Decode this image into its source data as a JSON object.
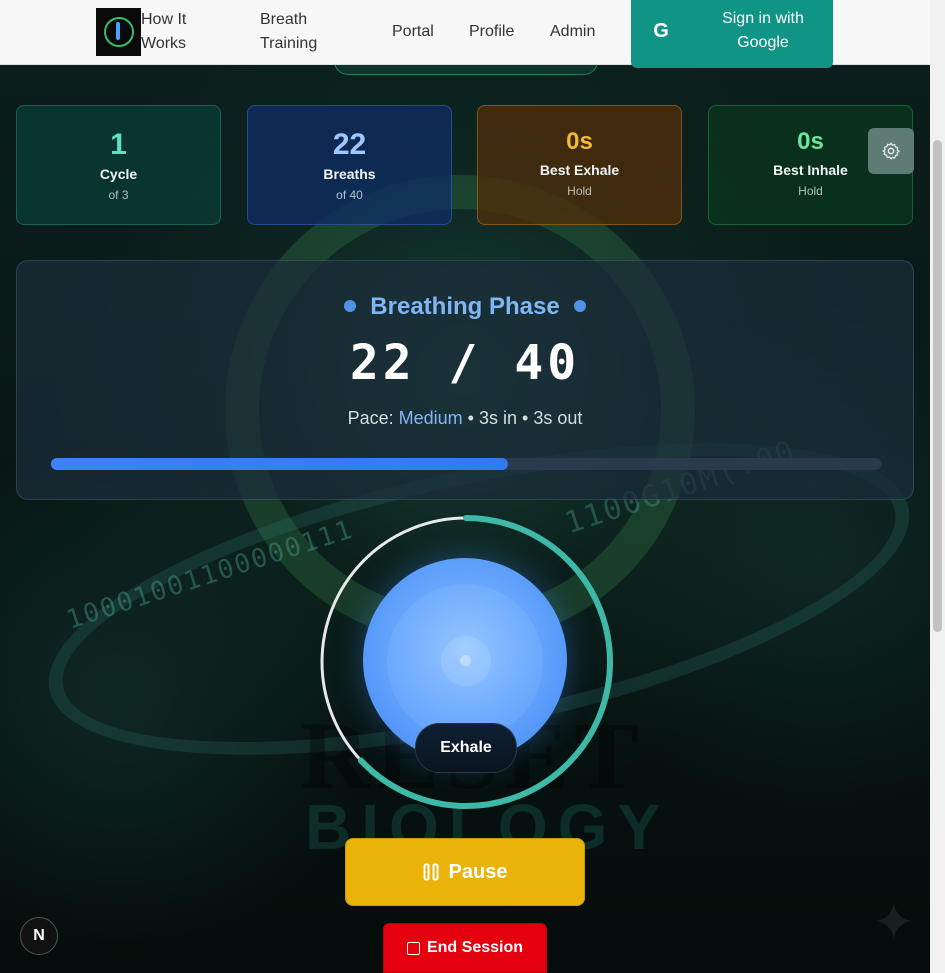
{
  "nav": {
    "links": [
      "How It Works",
      "Breath Training",
      "Portal",
      "Profile",
      "Admin"
    ],
    "signin_label": "Sign in with Google",
    "google_glyph": "G"
  },
  "stats": [
    {
      "value": "1",
      "label": "Cycle",
      "sub": "of 3",
      "color": "#5de0c8"
    },
    {
      "value": "22",
      "label": "Breaths",
      "sub": "of 40",
      "color": "#9fc7ff"
    },
    {
      "value": "0s",
      "label": "Best Exhale",
      "sub": "Hold",
      "color": "#f5b931"
    },
    {
      "value": "0s",
      "label": "Best Inhale",
      "sub": "Hold",
      "color": "#6ee49a"
    }
  ],
  "settings_icon": "gear-icon",
  "phase": {
    "title": "Breathing Phase",
    "count": "22 / 40",
    "pace_prefix": "Pace: ",
    "pace_value": "Medium",
    "pace_sep": " • ",
    "inhale": "3s in",
    "exhale": "3s out",
    "progress_fraction": 0.55
  },
  "breath_ring": {
    "progress_fraction": 0.63,
    "color": "#3fb9a7",
    "track_color": "#e8e8e8"
  },
  "current_phase_label": "Exhale",
  "buttons": {
    "pause": "Pause",
    "end": "End Session"
  },
  "badge": "N",
  "background": {
    "binary_1": "10001001100000111",
    "binary_2": "1100G10M(+00",
    "reset_text": "RESET",
    "bio_text": "BIOLOGY"
  }
}
